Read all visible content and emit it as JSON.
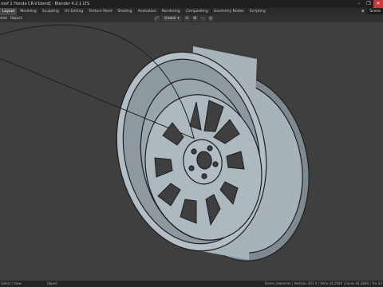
{
  "window": {
    "title": "roof 2 Honda CR-V.blend] - Blender 4.2.1 LTS",
    "controls": [
      "–",
      "❐",
      "✕"
    ]
  },
  "workspace_tabs": [
    {
      "label": "Layout",
      "active": true
    },
    {
      "label": "Modeling",
      "active": false
    },
    {
      "label": "Sculpting",
      "active": false
    },
    {
      "label": "UV Editing",
      "active": false
    },
    {
      "label": "Texture Paint",
      "active": false
    },
    {
      "label": "Shading",
      "active": false
    },
    {
      "label": "Animation",
      "active": false
    },
    {
      "label": "Rendering",
      "active": false
    },
    {
      "label": "Compositing",
      "active": false
    },
    {
      "label": "Geometry Nodes",
      "active": false
    },
    {
      "label": "Scripting",
      "active": false
    }
  ],
  "scene": {
    "name": "Scene"
  },
  "header": {
    "menu_items": [
      "Add",
      "Object"
    ],
    "transform_orientation": "Global"
  },
  "status": {
    "left_item_1": "Select / View",
    "left_item_2": "Object",
    "right_text": "Scene_elements | Vertices 203  V | Verts 44,2040 | Faces 44,3840 | Tris 43"
  },
  "colors": {
    "viewport_bg": "#3f3f3f",
    "wheel_body": "#a7b2b9",
    "wheel_shadow": "#7f8990",
    "wheel_edge": "#1c1f22",
    "active_tab": "#494949"
  }
}
